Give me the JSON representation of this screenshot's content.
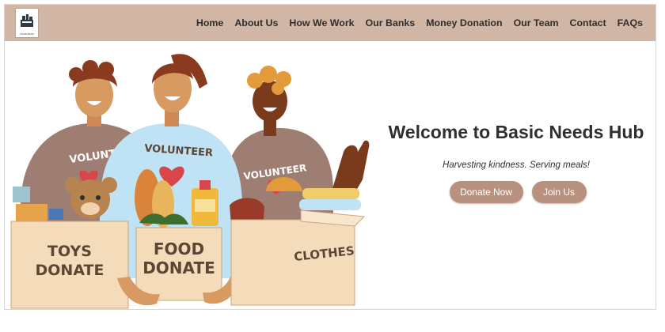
{
  "logo": {
    "caption": "FOOD BANK"
  },
  "nav": {
    "items": [
      {
        "label": "Home",
        "name": "nav-home"
      },
      {
        "label": "About Us",
        "name": "nav-about-us"
      },
      {
        "label": "How We Work",
        "name": "nav-how-we-work"
      },
      {
        "label": "Our Banks",
        "name": "nav-our-banks"
      },
      {
        "label": "Money Donation",
        "name": "nav-money-donation"
      },
      {
        "label": "Our Team",
        "name": "nav-our-team"
      },
      {
        "label": "Contact",
        "name": "nav-contact"
      },
      {
        "label": "FAQs",
        "name": "nav-faqs"
      }
    ]
  },
  "illustration": {
    "shirt_text": "VOLUNTEER",
    "box_toys_line1": "TOYS",
    "box_toys_line2": "DONATE",
    "box_food_line1": "FOOD",
    "box_food_line2": "DONATE",
    "box_clothes": "CLOTHES"
  },
  "hero": {
    "title": "Welcome to Basic Needs Hub",
    "subtitle": "Harvesting kindness. Serving meals!",
    "donate_label": "Donate Now",
    "join_label": "Join Us"
  },
  "colors": {
    "navbar": "#d2b6a5",
    "button": "#b9917f",
    "shirt_brown": "#9e7e72",
    "shirt_blue": "#bfe3f4",
    "box": "#f4dcbb",
    "heart": "#d9464a"
  }
}
